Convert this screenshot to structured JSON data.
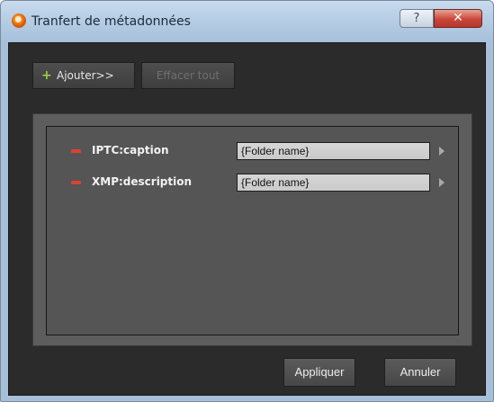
{
  "window": {
    "title": "Tranfert de métadonnées",
    "help_label": "?",
    "close_label": "✕"
  },
  "toolbar": {
    "add_icon": "+",
    "add_label": "Ajouter>>",
    "clear_label": "Effacer tout"
  },
  "mappings": [
    {
      "field": "IPTC:caption",
      "value": "{Folder name}"
    },
    {
      "field": "XMP:description",
      "value": "{Folder name}"
    }
  ],
  "footer": {
    "apply_label": "Appliquer",
    "cancel_label": "Annuler"
  },
  "colors": {
    "dialog_background": "#2b2b2b",
    "panel_background": "#555555",
    "add_icon": "#9ad23a",
    "remove_icon": "#e0412f",
    "close_button": "#c9473a"
  },
  "icons": {
    "app": "app-icon",
    "add": "plus-icon",
    "remove": "minus-icon",
    "expand": "chevron-right-icon"
  }
}
